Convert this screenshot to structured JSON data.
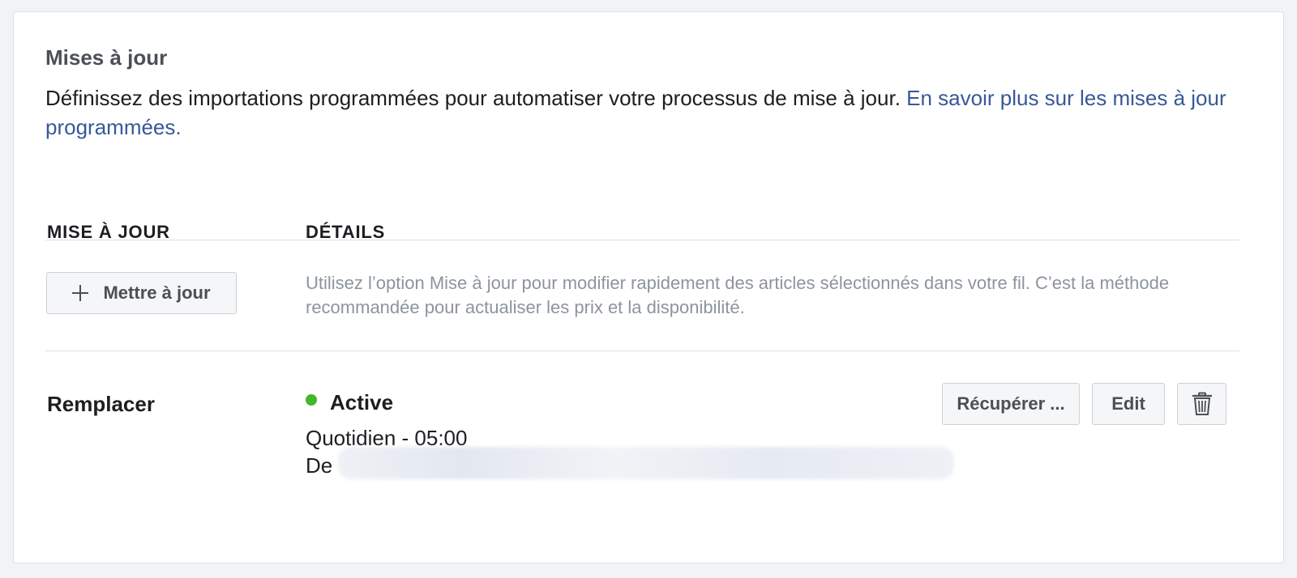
{
  "section": {
    "title": "Mises à jour",
    "description": "Définissez des importations programmées pour automatiser votre processus de mise à jour.",
    "learn_more_link": "En savoir plus sur les mises à jour programmées."
  },
  "table": {
    "headers": {
      "update": "MISE À JOUR",
      "details": "DÉTAILS"
    },
    "update_row": {
      "button_label": "Mettre à jour",
      "button_icon": "plus-icon",
      "helper_text": "Utilisez l’option Mise à jour pour modifier rapidement des articles sélectionnés dans votre fil. C’est la méthode recommandée pour actualiser les prix et la disponibilité."
    },
    "replace_row": {
      "label": "Remplacer",
      "status": "Active",
      "status_color": "#42b72a",
      "schedule": "Quotidien - 05:00",
      "source_prefix": "De",
      "actions": {
        "fetch_label": "Récupérer ...",
        "edit_label": "Edit",
        "delete_icon": "trash-icon"
      }
    }
  }
}
